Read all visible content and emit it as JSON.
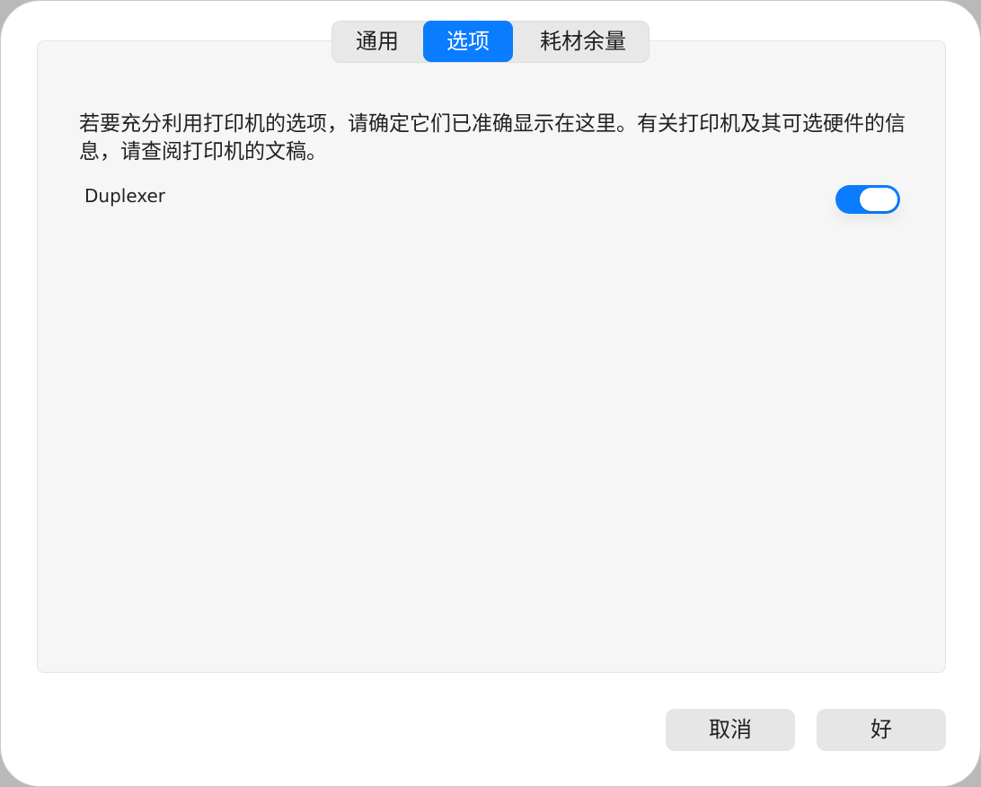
{
  "tabs": {
    "general": "通用",
    "options": "选项",
    "supply_levels": "耗材余量",
    "selected": "选项"
  },
  "content": {
    "description": "若要充分利用打印机的选项，请确定它们已准确显示在这里。有关打印机及其可选硬件的信息，请查阅打印机的文稿。",
    "options": [
      {
        "label": "Duplexer",
        "enabled": true
      }
    ]
  },
  "buttons": {
    "cancel": "取消",
    "ok": "好"
  },
  "colors": {
    "accent": "#0a7cff",
    "panel_background": "#f6f6f6",
    "button_background": "#e6e6e6"
  }
}
